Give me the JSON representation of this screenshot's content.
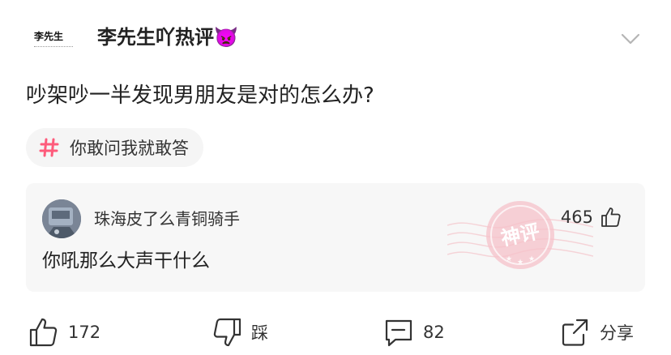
{
  "author": {
    "logo_text": "李先生",
    "name": "李先生吖热评👿"
  },
  "post": {
    "title": "吵架吵一半发现男朋友是对的怎么办?",
    "topic": "你敢问我就敢答"
  },
  "hot_comment": {
    "user": "珠海皮了么青铜骑手",
    "likes": "465",
    "text": "你吼那么大声干什么",
    "stamp_text": "神评"
  },
  "actions": {
    "like_count": "172",
    "dislike_label": "踩",
    "comment_count": "82",
    "share_label": "分享"
  },
  "colors": {
    "topic_hash": "#fe5b7b",
    "stamp": "#f4b6be",
    "card_bg": "#f7f7f7",
    "chip_bg": "#f5f5f5"
  }
}
